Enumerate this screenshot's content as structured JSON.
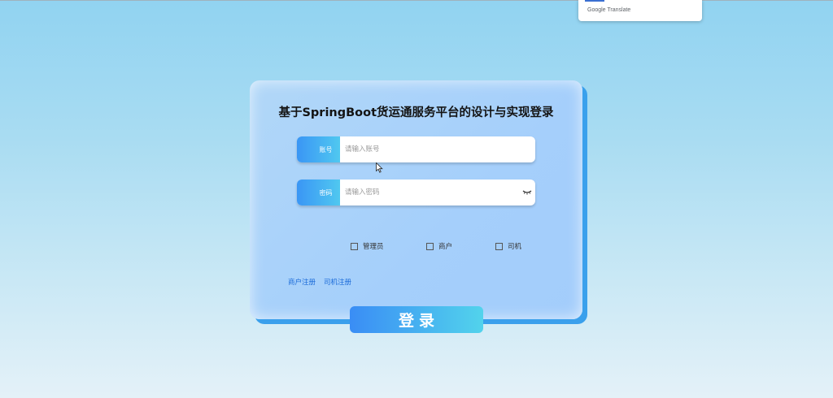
{
  "translate_popup": {
    "label": "Google Translate"
  },
  "login": {
    "title": "基于SpringBoot货运通服务平台的设计与实现登录",
    "account": {
      "label": "账号",
      "placeholder": "请输入账号"
    },
    "password": {
      "label": "密码",
      "placeholder": "请输入密码",
      "toggle_icon": "eye-closed-icon"
    },
    "roles": [
      {
        "label": "管理员",
        "checked": false
      },
      {
        "label": "商户",
        "checked": false
      },
      {
        "label": "司机",
        "checked": false
      }
    ],
    "links": {
      "merchant_register": "商户注册",
      "driver_register": "司机注册"
    },
    "submit_label": "登录"
  },
  "colors": {
    "accent_start": "#3a8df5",
    "accent_end": "#52d3ec",
    "link": "#1a6ad8",
    "card_shadow": "#3aa0ec"
  }
}
